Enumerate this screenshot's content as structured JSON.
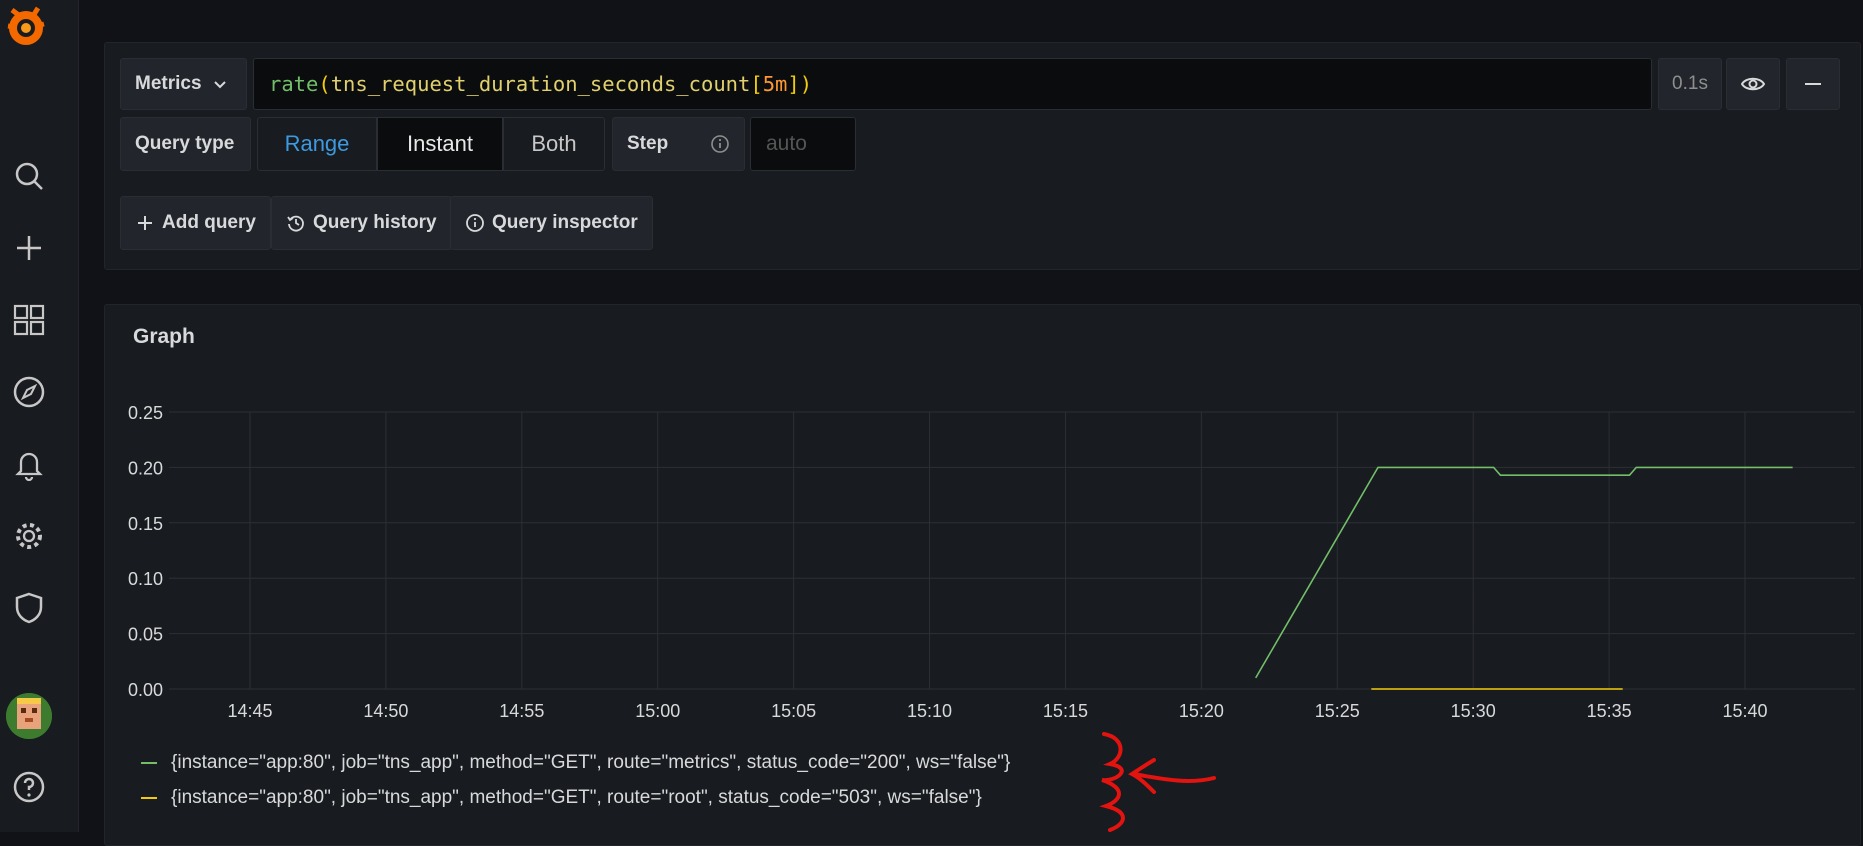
{
  "sidebar": {
    "items": [
      {
        "icon": "search-icon"
      },
      {
        "icon": "plus-icon"
      },
      {
        "icon": "dashboards-icon"
      },
      {
        "icon": "explore-icon"
      },
      {
        "icon": "bell-icon"
      },
      {
        "icon": "gear-icon"
      },
      {
        "icon": "shield-icon"
      },
      {
        "icon": "help-icon"
      }
    ]
  },
  "query": {
    "datasource_label": "Metrics",
    "expr_fn": "rate",
    "expr_open": "(",
    "expr_metric": "tns_request_duration_seconds_count",
    "expr_range_open": "[",
    "expr_range": "5m",
    "expr_range_close": "]",
    "expr_close": ")",
    "duration": "0.1s",
    "query_type_label": "Query type",
    "query_types": [
      "Range",
      "Instant",
      "Both"
    ],
    "selected_query_type": "Range",
    "step_label": "Step",
    "step_placeholder": "auto",
    "add_query": "Add query",
    "query_history": "Query history",
    "query_inspector": "Query inspector"
  },
  "graph": {
    "title": "Graph"
  },
  "chart_data": {
    "type": "line",
    "ylim": [
      0,
      0.25
    ],
    "yticks": [
      "0.00",
      "0.05",
      "0.10",
      "0.15",
      "0.20",
      "0.25"
    ],
    "xticks": [
      "14:45",
      "14:50",
      "14:55",
      "15:00",
      "15:05",
      "15:10",
      "15:15",
      "15:20",
      "15:25",
      "15:30",
      "15:35",
      "15:40"
    ],
    "grid": true,
    "legend": "bottom",
    "series": [
      {
        "name": "{instance=\"app:80\", job=\"tns_app\", method=\"GET\", route=\"metrics\", status_code=\"200\", ws=\"false\"}",
        "color": "#73bf69",
        "points": [
          [
            "15:22",
            0.01
          ],
          [
            "15:26:30",
            0.2
          ],
          [
            "15:30:45",
            0.2
          ],
          [
            "15:31",
            0.193
          ],
          [
            "15:35:45",
            0.193
          ],
          [
            "15:36",
            0.2
          ],
          [
            "15:41:45",
            0.2
          ]
        ]
      },
      {
        "name": "{instance=\"app:80\", job=\"tns_app\", method=\"GET\", route=\"root\", status_code=\"503\", ws=\"false\"}",
        "color": "#f2cc0c",
        "points": [
          [
            "15:26:15",
            0.0
          ],
          [
            "15:35:30",
            0.0
          ]
        ]
      }
    ]
  }
}
